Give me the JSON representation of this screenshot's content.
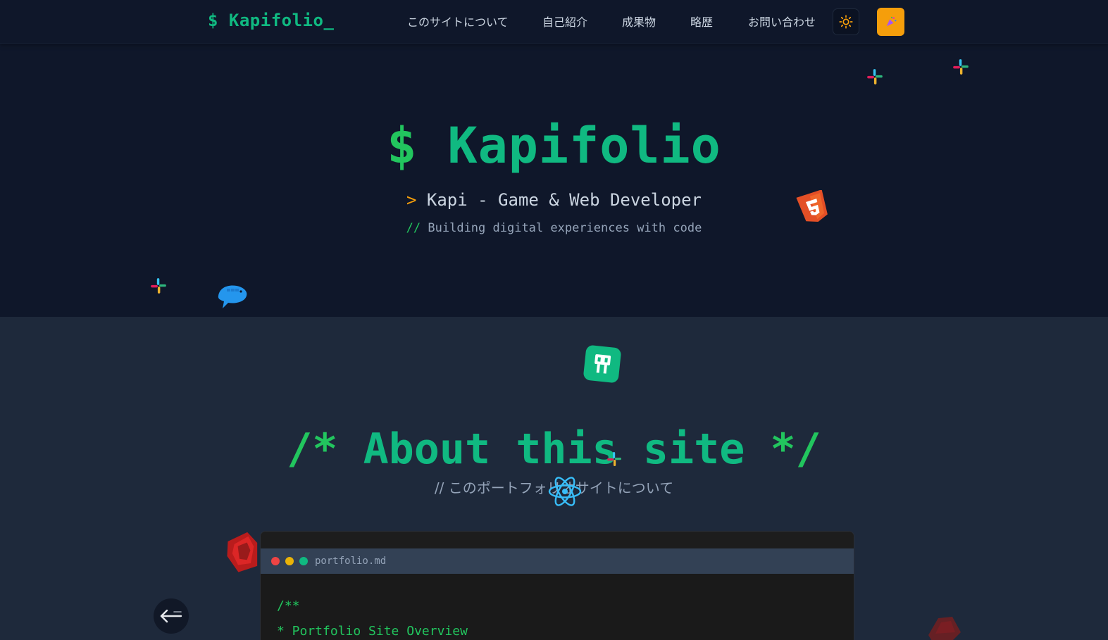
{
  "header": {
    "logo": "$ Kapifolio_",
    "nav": [
      "このサイトについて",
      "自己紹介",
      "成果物",
      "略歴",
      "お問い合わせ"
    ],
    "theme_icon": "sun-icon",
    "easter_icon": "party-popper-icon"
  },
  "hero": {
    "title_prefix": "$",
    "title": "Kapifolio",
    "subtitle_prompt": ">",
    "subtitle": "Kapi - Game & Web Developer",
    "tagline_slashes": "//",
    "tagline": "Building digital experiences with code"
  },
  "about": {
    "title_open": "/*",
    "title": "About this site",
    "title_close": "*/",
    "subtitle": "// このポートフォリオサイトについて"
  },
  "code_window": {
    "filename": "portfolio.md",
    "lines": [
      "/**",
      "* Portfolio Site Overview"
    ]
  },
  "decor_icons": [
    "slack-icon",
    "docker-icon",
    "html5-icon",
    "gatsby-icon",
    "react-icon",
    "ruby-icon",
    "back-arrow-icon"
  ],
  "colors": {
    "accent": "#10b981",
    "accent_bright": "#22c55e",
    "warning": "#f59e0b",
    "hero_bg": "#0f172a",
    "section_bg": "#1e293b"
  }
}
